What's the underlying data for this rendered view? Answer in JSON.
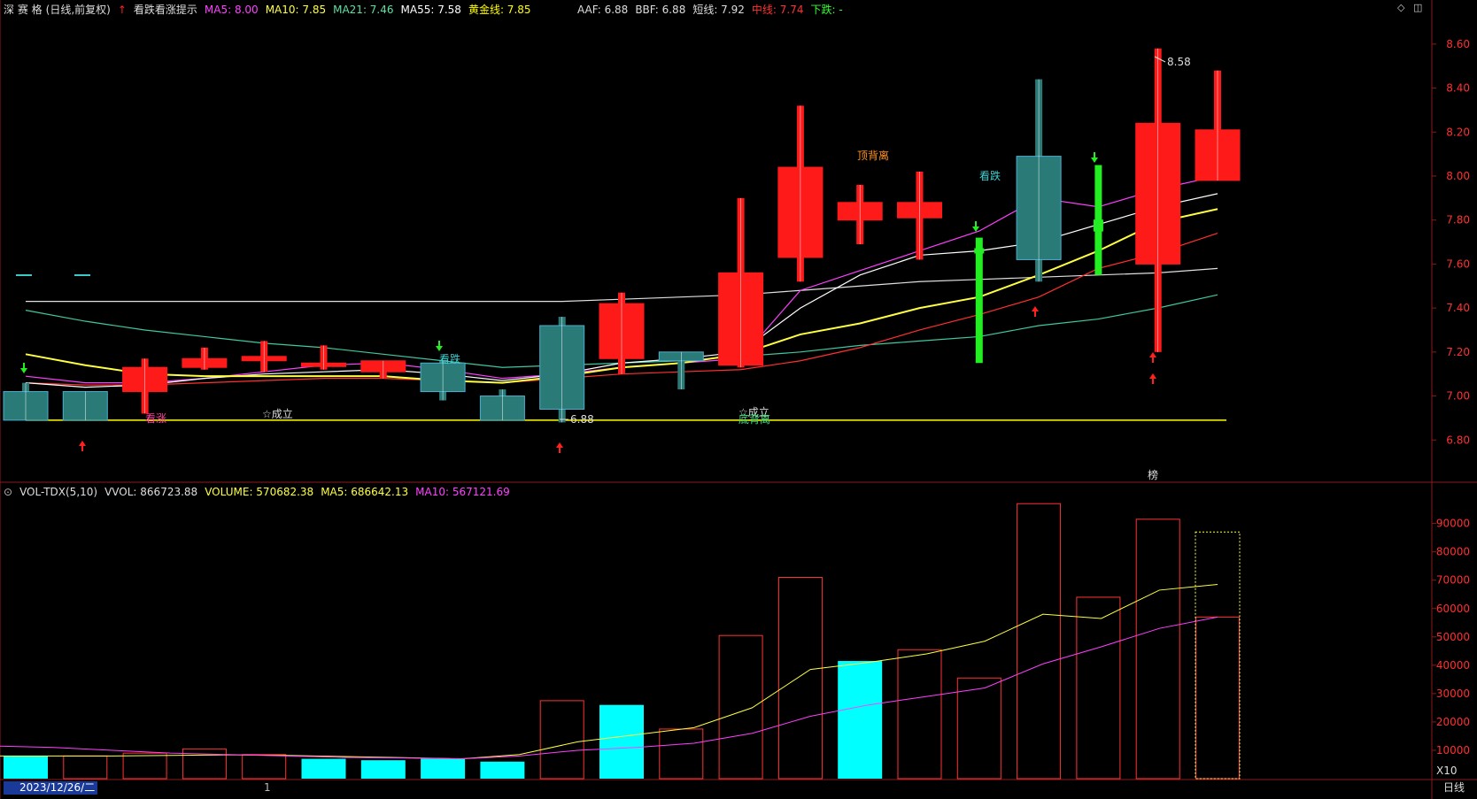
{
  "colors": {
    "up": "#ff1a1a",
    "down": "#2a7a78",
    "green_candle": "#22ee22",
    "vol_up": "#ff3333",
    "vol_down": "#00ffff",
    "ma5": "#ffffff",
    "ma10": "#ff40ff",
    "ma21": "#ffff40",
    "ma55": "#ff3030",
    "ma_long1": "#e0e0e0",
    "ma_long2": "#40c8a0",
    "gold_line": "#ffff00"
  },
  "header": {
    "stock_name": "深 赛 格",
    "period": "(日线,前复权)",
    "indicator_name": "看跌看涨提示",
    "ma5": "MA5: 8.00",
    "ma10": "MA10: 7.85",
    "ma21": "MA21: 7.46",
    "ma55": "MA55: 7.58",
    "gold": "黄金线: 7.85",
    "aaf": "AAF: 6.88",
    "bbf": "BBF: 6.88",
    "short": "短线: 7.92",
    "mid": "中线: 7.74",
    "down": "下跌: -"
  },
  "vol_header": {
    "name": "VOL-TDX(5,10)",
    "vvol": "VVOL: 866723.88",
    "volume": "VOLUME: 570682.38",
    "ma5": "MA5: 686642.13",
    "ma10": "MA10: 567121.69"
  },
  "annotations": {
    "max_label": "8.58",
    "min_label": "6.88",
    "top_divergence": "顶背离",
    "bearish": "看跌",
    "bearish2": "看跌",
    "bullish": "看涨",
    "established1": "☆成立",
    "established2": "☆成立",
    "bottom_div": "底背离",
    "corner_char": "榜"
  },
  "footer": {
    "date": "2023/12/26/二",
    "scale": "X10",
    "period_btn": "日线",
    "marker": "1"
  },
  "chart_data": [
    {
      "type": "candlestick",
      "ylim": [
        6.62,
        8.72
      ],
      "yticks": [
        "8.60",
        "8.40",
        "8.20",
        "8.00",
        "7.80",
        "7.60",
        "7.40",
        "7.20",
        "7.00",
        "6.80"
      ],
      "candles": [
        {
          "open": 7.02,
          "close": 6.89,
          "high": 7.06,
          "low": 6.89,
          "color": "down"
        },
        {
          "open": 7.02,
          "close": 6.89,
          "high": 7.02,
          "low": 6.89,
          "color": "down"
        },
        {
          "open": 7.02,
          "close": 7.13,
          "high": 7.17,
          "low": 6.92,
          "color": "up"
        },
        {
          "open": 7.13,
          "close": 7.17,
          "high": 7.22,
          "low": 7.12,
          "color": "up"
        },
        {
          "open": 7.16,
          "close": 7.18,
          "high": 7.25,
          "low": 7.11,
          "color": "up"
        },
        {
          "open": 7.14,
          "close": 7.15,
          "high": 7.23,
          "low": 7.12,
          "color": "up"
        },
        {
          "open": 7.11,
          "close": 7.16,
          "high": 7.16,
          "low": 7.08,
          "color": "up"
        },
        {
          "open": 7.15,
          "close": 7.02,
          "high": 7.16,
          "low": 6.98,
          "color": "down"
        },
        {
          "open": 7.0,
          "close": 6.89,
          "high": 7.03,
          "low": 6.89,
          "color": "down"
        },
        {
          "open": 6.94,
          "close": 7.32,
          "high": 7.36,
          "low": 6.88,
          "color": "down"
        },
        {
          "open": 7.17,
          "close": 7.42,
          "high": 7.47,
          "low": 7.1,
          "color": "up"
        },
        {
          "open": 7.2,
          "close": 7.16,
          "high": 7.2,
          "low": 7.03,
          "color": "down"
        },
        {
          "open": 7.14,
          "close": 7.56,
          "high": 7.9,
          "low": 7.13,
          "color": "up"
        },
        {
          "open": 7.63,
          "close": 8.04,
          "high": 8.32,
          "low": 7.52,
          "color": "up"
        },
        {
          "open": 7.8,
          "close": 7.88,
          "high": 7.96,
          "low": 7.69,
          "color": "up"
        },
        {
          "open": 7.81,
          "close": 7.88,
          "high": 8.02,
          "low": 7.62,
          "color": "up"
        },
        {
          "open": 7.67,
          "close": 7.65,
          "high": 7.72,
          "low": 7.15,
          "color": "green"
        },
        {
          "open": 8.09,
          "close": 7.62,
          "high": 8.44,
          "low": 7.52,
          "color": "down"
        },
        {
          "open": 7.8,
          "close": 7.75,
          "high": 8.05,
          "low": 7.55,
          "color": "green"
        },
        {
          "open": 7.6,
          "close": 8.24,
          "high": 8.58,
          "low": 7.2,
          "color": "up"
        },
        {
          "open": 7.98,
          "close": 8.21,
          "high": 8.48,
          "low": 7.98,
          "color": "up"
        }
      ],
      "ma_lines": {
        "ma5": [
          7.06,
          7.04,
          7.05,
          7.08,
          7.1,
          7.11,
          7.12,
          7.1,
          7.07,
          7.1,
          7.15,
          7.17,
          7.2,
          7.4,
          7.55,
          7.64,
          7.66,
          7.7,
          7.78,
          7.86,
          7.92
        ],
        "ma10": [
          7.09,
          7.06,
          7.06,
          7.08,
          7.11,
          7.14,
          7.15,
          7.12,
          7.08,
          7.1,
          7.13,
          7.15,
          7.17,
          7.48,
          7.57,
          7.66,
          7.75,
          7.9,
          7.86,
          7.94,
          8.0
        ],
        "ma21": [
          7.19,
          7.14,
          7.1,
          7.09,
          7.09,
          7.09,
          7.09,
          7.07,
          7.06,
          7.09,
          7.13,
          7.15,
          7.19,
          7.28,
          7.33,
          7.4,
          7.45,
          7.55,
          7.66,
          7.79,
          7.85
        ],
        "ma55": [
          7.06,
          7.05,
          7.05,
          7.06,
          7.07,
          7.08,
          7.08,
          7.07,
          7.06,
          7.08,
          7.1,
          7.11,
          7.12,
          7.16,
          7.22,
          7.3,
          7.37,
          7.45,
          7.58,
          7.65,
          7.74
        ],
        "ma_long1": [
          7.43,
          7.43,
          7.43,
          7.43,
          7.43,
          7.43,
          7.43,
          7.43,
          7.43,
          7.43,
          7.44,
          7.45,
          7.46,
          7.48,
          7.5,
          7.52,
          7.53,
          7.54,
          7.55,
          7.56,
          7.58
        ],
        "ma_long2": [
          7.39,
          7.34,
          7.3,
          7.27,
          7.24,
          7.22,
          7.19,
          7.16,
          7.13,
          7.14,
          7.15,
          7.16,
          7.18,
          7.2,
          7.23,
          7.25,
          7.27,
          7.32,
          7.35,
          7.4,
          7.46
        ]
      },
      "gold_line": 6.89
    },
    {
      "type": "bar",
      "ylim": [
        0,
        98000
      ],
      "yticks": [
        "90000",
        "80000",
        "70000",
        "60000",
        "50000",
        "40000",
        "30000",
        "20000",
        "10000"
      ],
      "values": [
        8000,
        8000,
        9000,
        10500,
        8500,
        7000,
        6500,
        7000,
        6000,
        27500,
        26000,
        17500,
        50500,
        71000,
        41500,
        45500,
        35500,
        97000,
        64000,
        91500,
        57000
      ],
      "kinds": [
        "down",
        "up",
        "up",
        "up",
        "up",
        "down",
        "down",
        "down",
        "down",
        "up",
        "down",
        "up",
        "up",
        "up",
        "down",
        "up",
        "up",
        "up",
        "up",
        "up",
        "up"
      ],
      "ma5": [
        8000,
        8000,
        8000,
        8200,
        8400,
        8200,
        7800,
        7400,
        7000,
        8500,
        13000,
        15500,
        18000,
        25000,
        38500,
        41000,
        44000,
        48500,
        58000,
        56500,
        66500,
        68500
      ],
      "ma10": [
        11500,
        11000,
        10000,
        9000,
        8500,
        8000,
        7500,
        7300,
        7000,
        8000,
        10000,
        11000,
        12500,
        16000,
        22000,
        26000,
        29000,
        32000,
        40500,
        46500,
        53000,
        57000
      ],
      "dotted_outline_value": 87000
    }
  ]
}
